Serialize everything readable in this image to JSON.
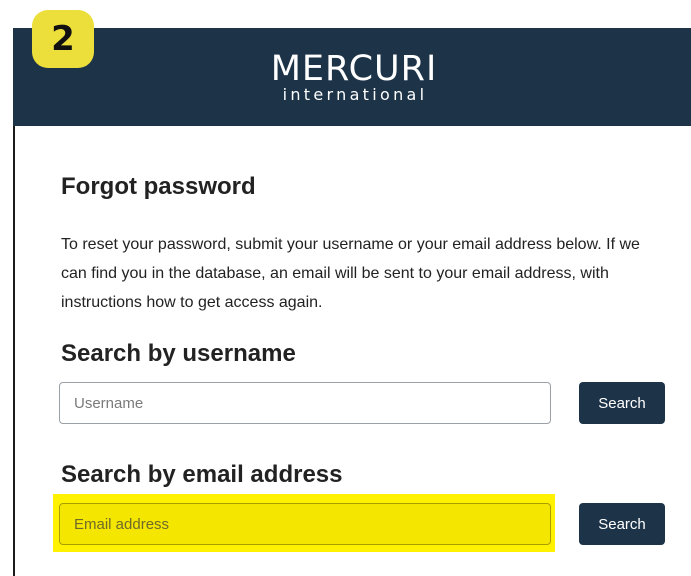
{
  "badge": {
    "number": "2"
  },
  "header": {
    "logo_main": "MERCURI",
    "logo_sub": "international"
  },
  "page": {
    "title": "Forgot password",
    "description": "To reset your password, submit your username or your email address below. If we can find you in the database, an email will be sent to your email address, with instructions how to get access again."
  },
  "username_section": {
    "title": "Search by username",
    "placeholder": "Username",
    "button_label": "Search"
  },
  "email_section": {
    "title": "Search by email address",
    "placeholder": "Email address",
    "button_label": "Search",
    "highlight_color": "#fff200"
  },
  "colors": {
    "brand": "#1c3348",
    "badge": "#ecdf3c"
  }
}
